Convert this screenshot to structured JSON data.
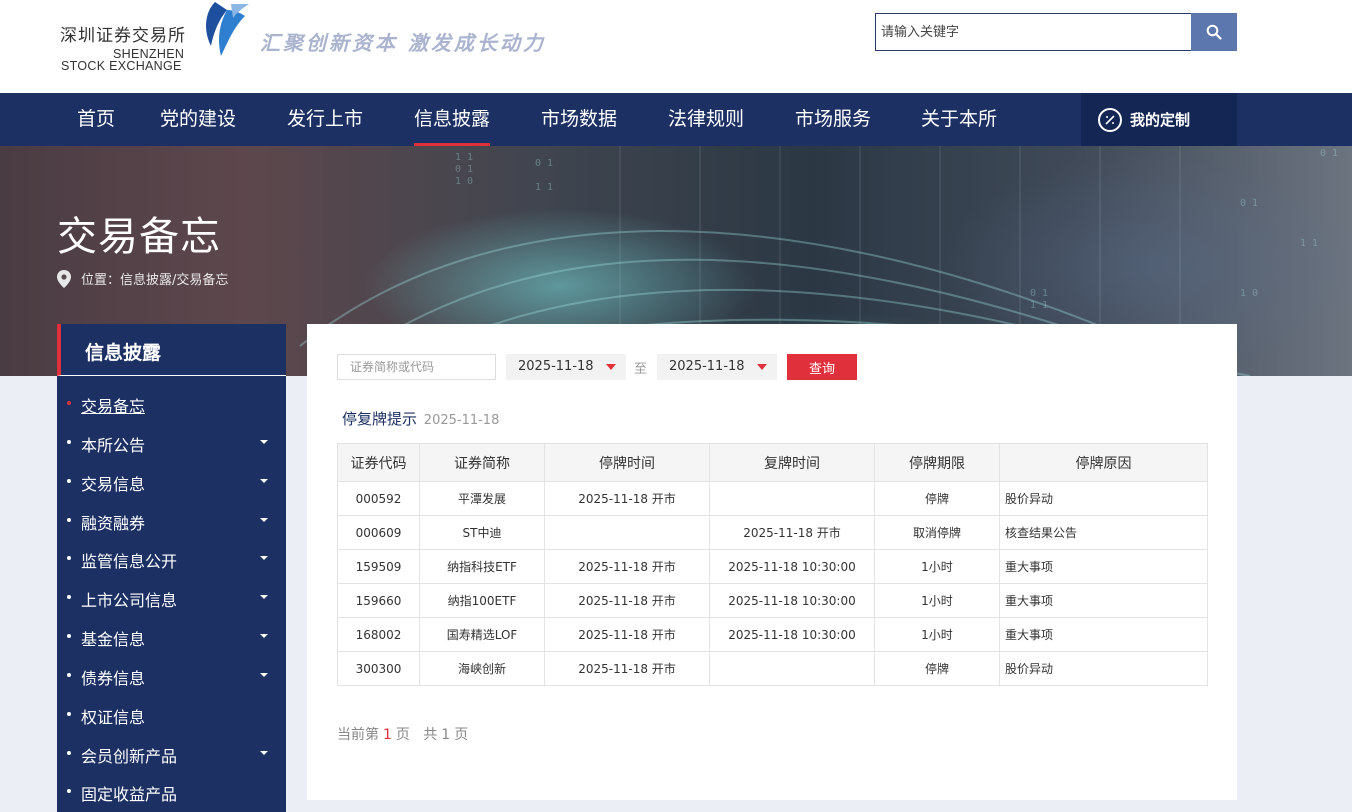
{
  "header": {
    "logo_cn": "深圳证券交易所",
    "logo_en_line1": "SHENZHEN",
    "logo_en_line2": "STOCK EXCHANGE",
    "slogan": "汇聚创新资本 激发成长动力",
    "search_placeholder": "请输入关键字",
    "search_icon": "search-icon"
  },
  "nav": {
    "items": [
      "首页",
      "党的建设",
      "发行上市",
      "信息披露",
      "市场数据",
      "法律规则",
      "市场服务",
      "关于本所"
    ],
    "active": "信息披露",
    "custom_label": "我的定制"
  },
  "banner": {
    "title": "交易备忘",
    "breadcrumb": "位置：信息披露/交易备忘"
  },
  "sidebar": {
    "title": "信息披露",
    "items": [
      {
        "label": "交易备忘",
        "active": true,
        "expandable": false
      },
      {
        "label": "本所公告",
        "expandable": true
      },
      {
        "label": "交易信息",
        "expandable": true
      },
      {
        "label": "融资融券",
        "expandable": true
      },
      {
        "label": "监管信息公开",
        "expandable": true
      },
      {
        "label": "上市公司信息",
        "expandable": true
      },
      {
        "label": "基金信息",
        "expandable": true
      },
      {
        "label": "债券信息",
        "expandable": true
      },
      {
        "label": "权证信息",
        "expandable": false
      },
      {
        "label": "会员创新产品",
        "expandable": true
      },
      {
        "label": "固定收益产品",
        "expandable": false
      }
    ]
  },
  "filter": {
    "code_placeholder": "证券简称或代码",
    "date_from": "2025-11-18",
    "to_label": "至",
    "date_to": "2025-11-18",
    "query_label": "查询"
  },
  "section": {
    "title": "停复牌提示",
    "date": "2025-11-18"
  },
  "table": {
    "headers": [
      "证券代码",
      "证券简称",
      "停牌时间",
      "复牌时间",
      "停牌期限",
      "停牌原因"
    ],
    "rows": [
      [
        "000592",
        "平潭发展",
        "2025-11-18 开市",
        "",
        "停牌",
        "股价异动"
      ],
      [
        "000609",
        "ST中迪",
        "",
        "2025-11-18 开市",
        "取消停牌",
        "核查结果公告"
      ],
      [
        "159509",
        "纳指科技ETF",
        "2025-11-18 开市",
        "2025-11-18 10:30:00",
        "1小时",
        "重大事项"
      ],
      [
        "159660",
        "纳指100ETF",
        "2025-11-18 开市",
        "2025-11-18 10:30:00",
        "1小时",
        "重大事项"
      ],
      [
        "168002",
        "国寿精选LOF",
        "2025-11-18 开市",
        "2025-11-18 10:30:00",
        "1小时",
        "重大事项"
      ],
      [
        "300300",
        "海峡创新",
        "2025-11-18 开市",
        "",
        "停牌",
        "股价异动"
      ]
    ]
  },
  "pager": {
    "prefix": "当前第",
    "current": "1",
    "page_word": "页",
    "total_prefix": "共",
    "total": "1",
    "total_suffix": "页"
  },
  "colors": {
    "navy": "#1c3063",
    "accent_red": "#e0303c",
    "search_button": "#5b77ad"
  }
}
